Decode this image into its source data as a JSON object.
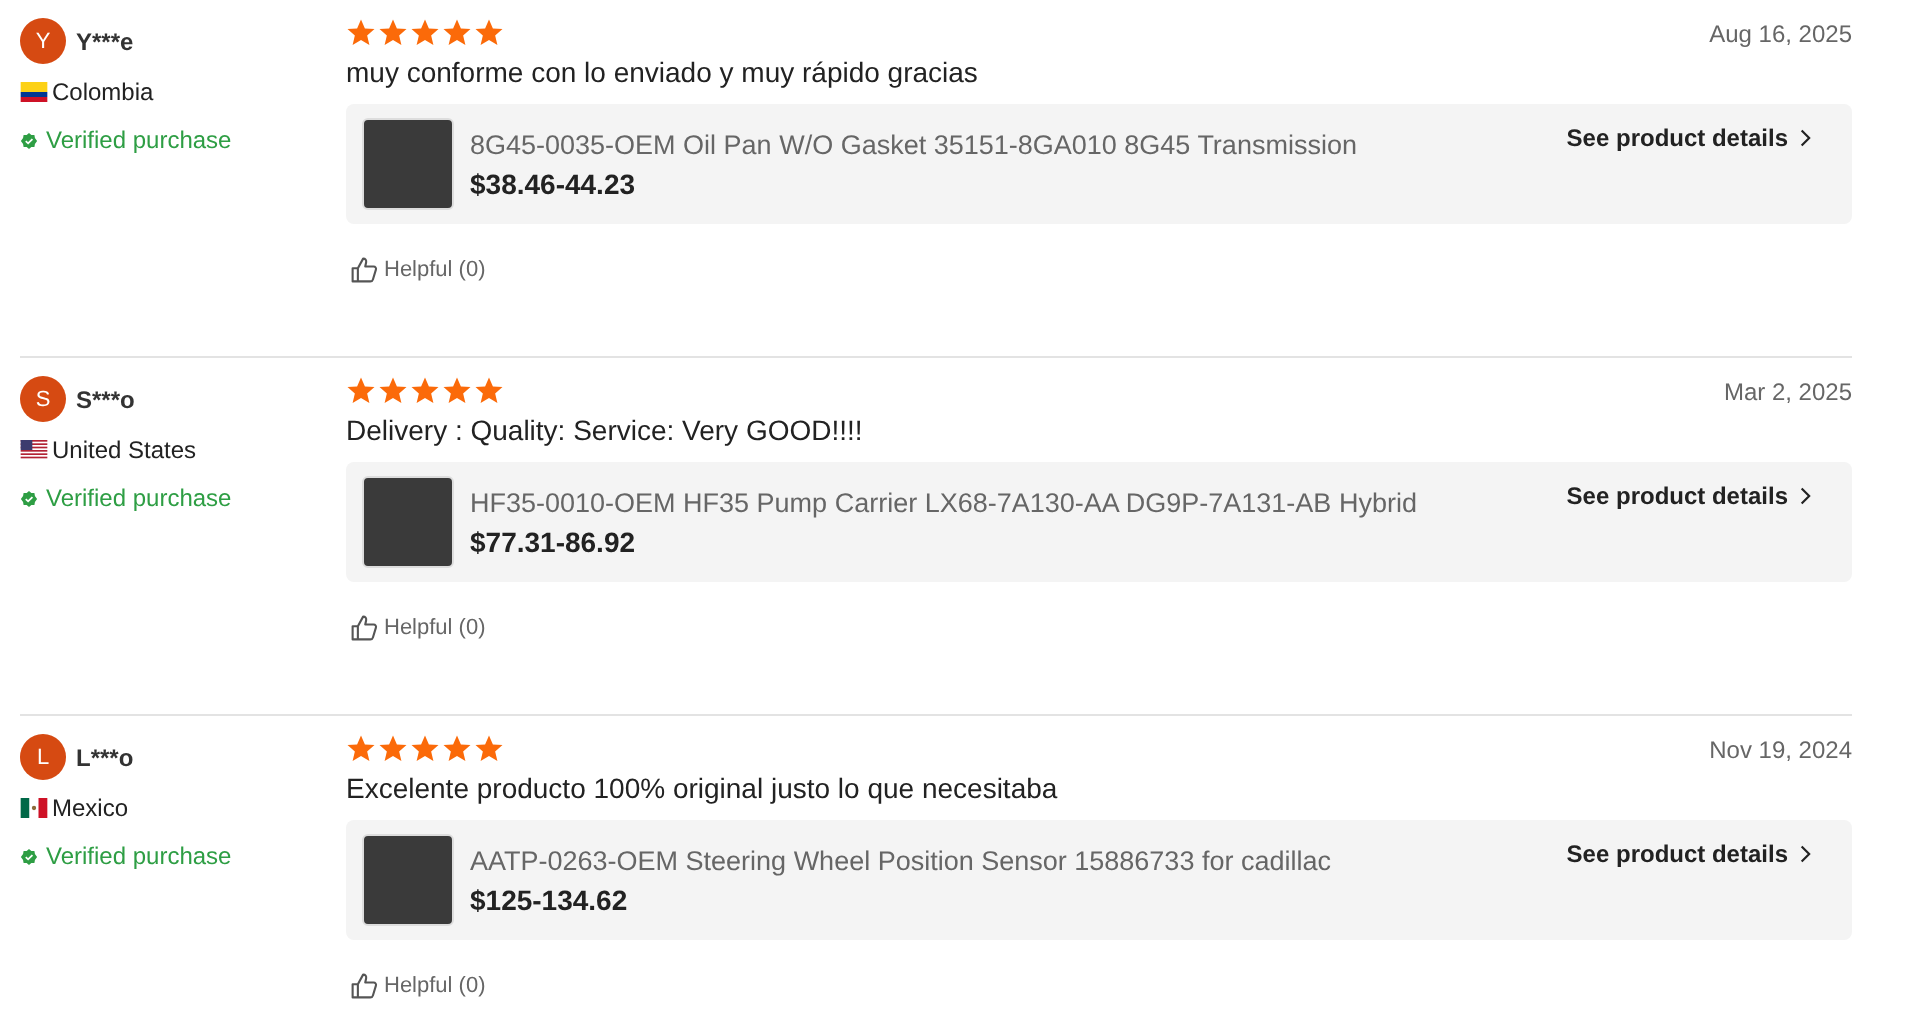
{
  "reviews": [
    {
      "initial": "Y",
      "user": "Y***e",
      "country": {
        "name": "Colombia",
        "kind": "co"
      },
      "verified": "Verified purchase",
      "stars": 5,
      "date": "Aug 16, 2025",
      "text": "muy conforme con lo enviado y muy rápido gracias",
      "product": {
        "title": "8G45-0035-OEM Oil Pan W/O Gasket 35151-8GA010 8G45 Transmission",
        "price": "$38.46-44.23",
        "link": "See product details"
      },
      "helpful": "Helpful (0)"
    },
    {
      "initial": "S",
      "user": "S***o",
      "country": {
        "name": "United States",
        "kind": "us"
      },
      "verified": "Verified purchase",
      "stars": 5,
      "date": "Mar 2, 2025",
      "text": "Delivery :  Quality:  Service: Very GOOD!!!!",
      "product": {
        "title": "HF35-0010-OEM HF35 Pump Carrier LX68-7A130-AA DG9P-7A131-AB Hybrid",
        "price": "$77.31-86.92",
        "link": "See product details"
      },
      "helpful": "Helpful (0)"
    },
    {
      "initial": "L",
      "user": "L***o",
      "country": {
        "name": "Mexico",
        "kind": "mx"
      },
      "verified": "Verified purchase",
      "stars": 5,
      "date": "Nov 19, 2024",
      "text": "Excelente producto 100% original justo lo que necesitaba",
      "product": {
        "title": "AATP-0263-OEM Steering Wheel Position Sensor 15886733 for cadillac",
        "price": "$125-134.62",
        "link": "See product details"
      },
      "helpful": "Helpful (0)"
    }
  ]
}
